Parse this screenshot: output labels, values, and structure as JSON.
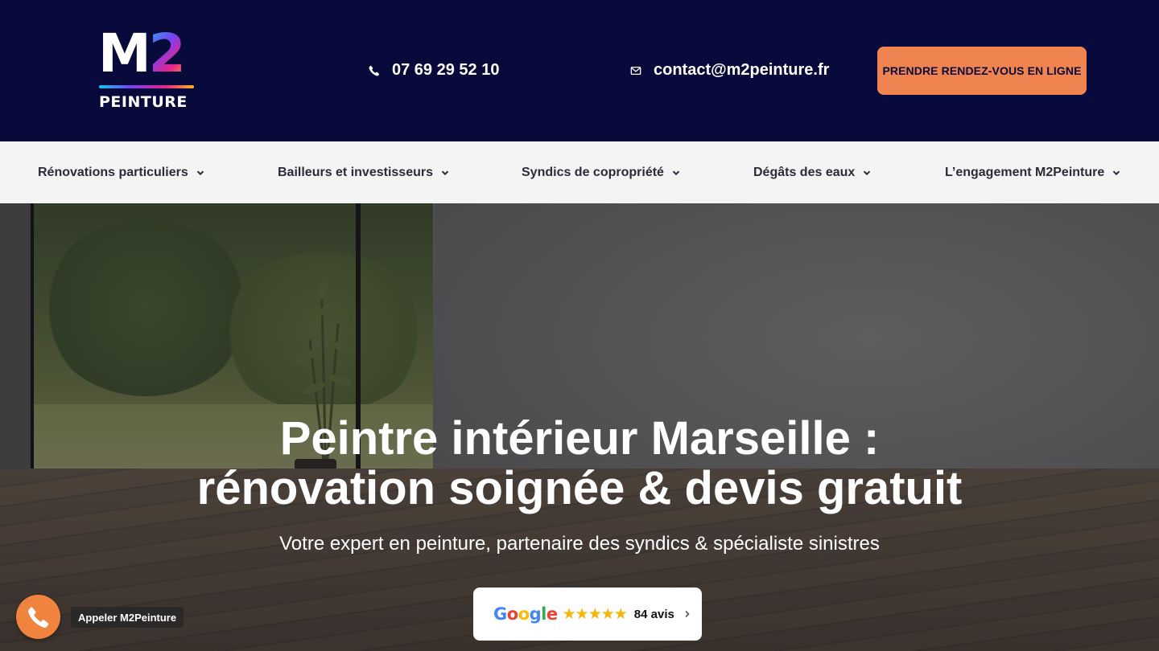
{
  "header": {
    "logo": {
      "mark": "M2",
      "wordmark": "PEINTURE"
    },
    "phone": {
      "icon": "phone-icon",
      "label": "07 69 29 52 10"
    },
    "email": {
      "icon": "envelope-icon",
      "label": "contact@m2peinture.fr"
    },
    "cta_label": "PRENDRE RENDEZ-VOUS EN LIGNE",
    "colors": {
      "background": "#080a3b",
      "cta": "#f08451"
    }
  },
  "nav": {
    "items": [
      {
        "label": "Rénovations particuliers"
      },
      {
        "label": "Bailleurs et investisseurs"
      },
      {
        "label": "Syndics de copropriété"
      },
      {
        "label": "Dégâts des eaux"
      },
      {
        "label": "L’engagement M2Peinture"
      }
    ]
  },
  "hero": {
    "title_line1": "Peintre intérieur Marseille :",
    "title_line2": "rénovation soignée & devis gratuit",
    "subtitle": "Votre expert en peinture, partenaire des syndics & spécialiste sinistres",
    "reviews": {
      "brand": "Google",
      "rating": 5,
      "stars": "★★★★★",
      "count_label": "84 avis"
    }
  },
  "floating": {
    "call_label": "Appeler M2Peinture",
    "icon": "phone-icon"
  }
}
